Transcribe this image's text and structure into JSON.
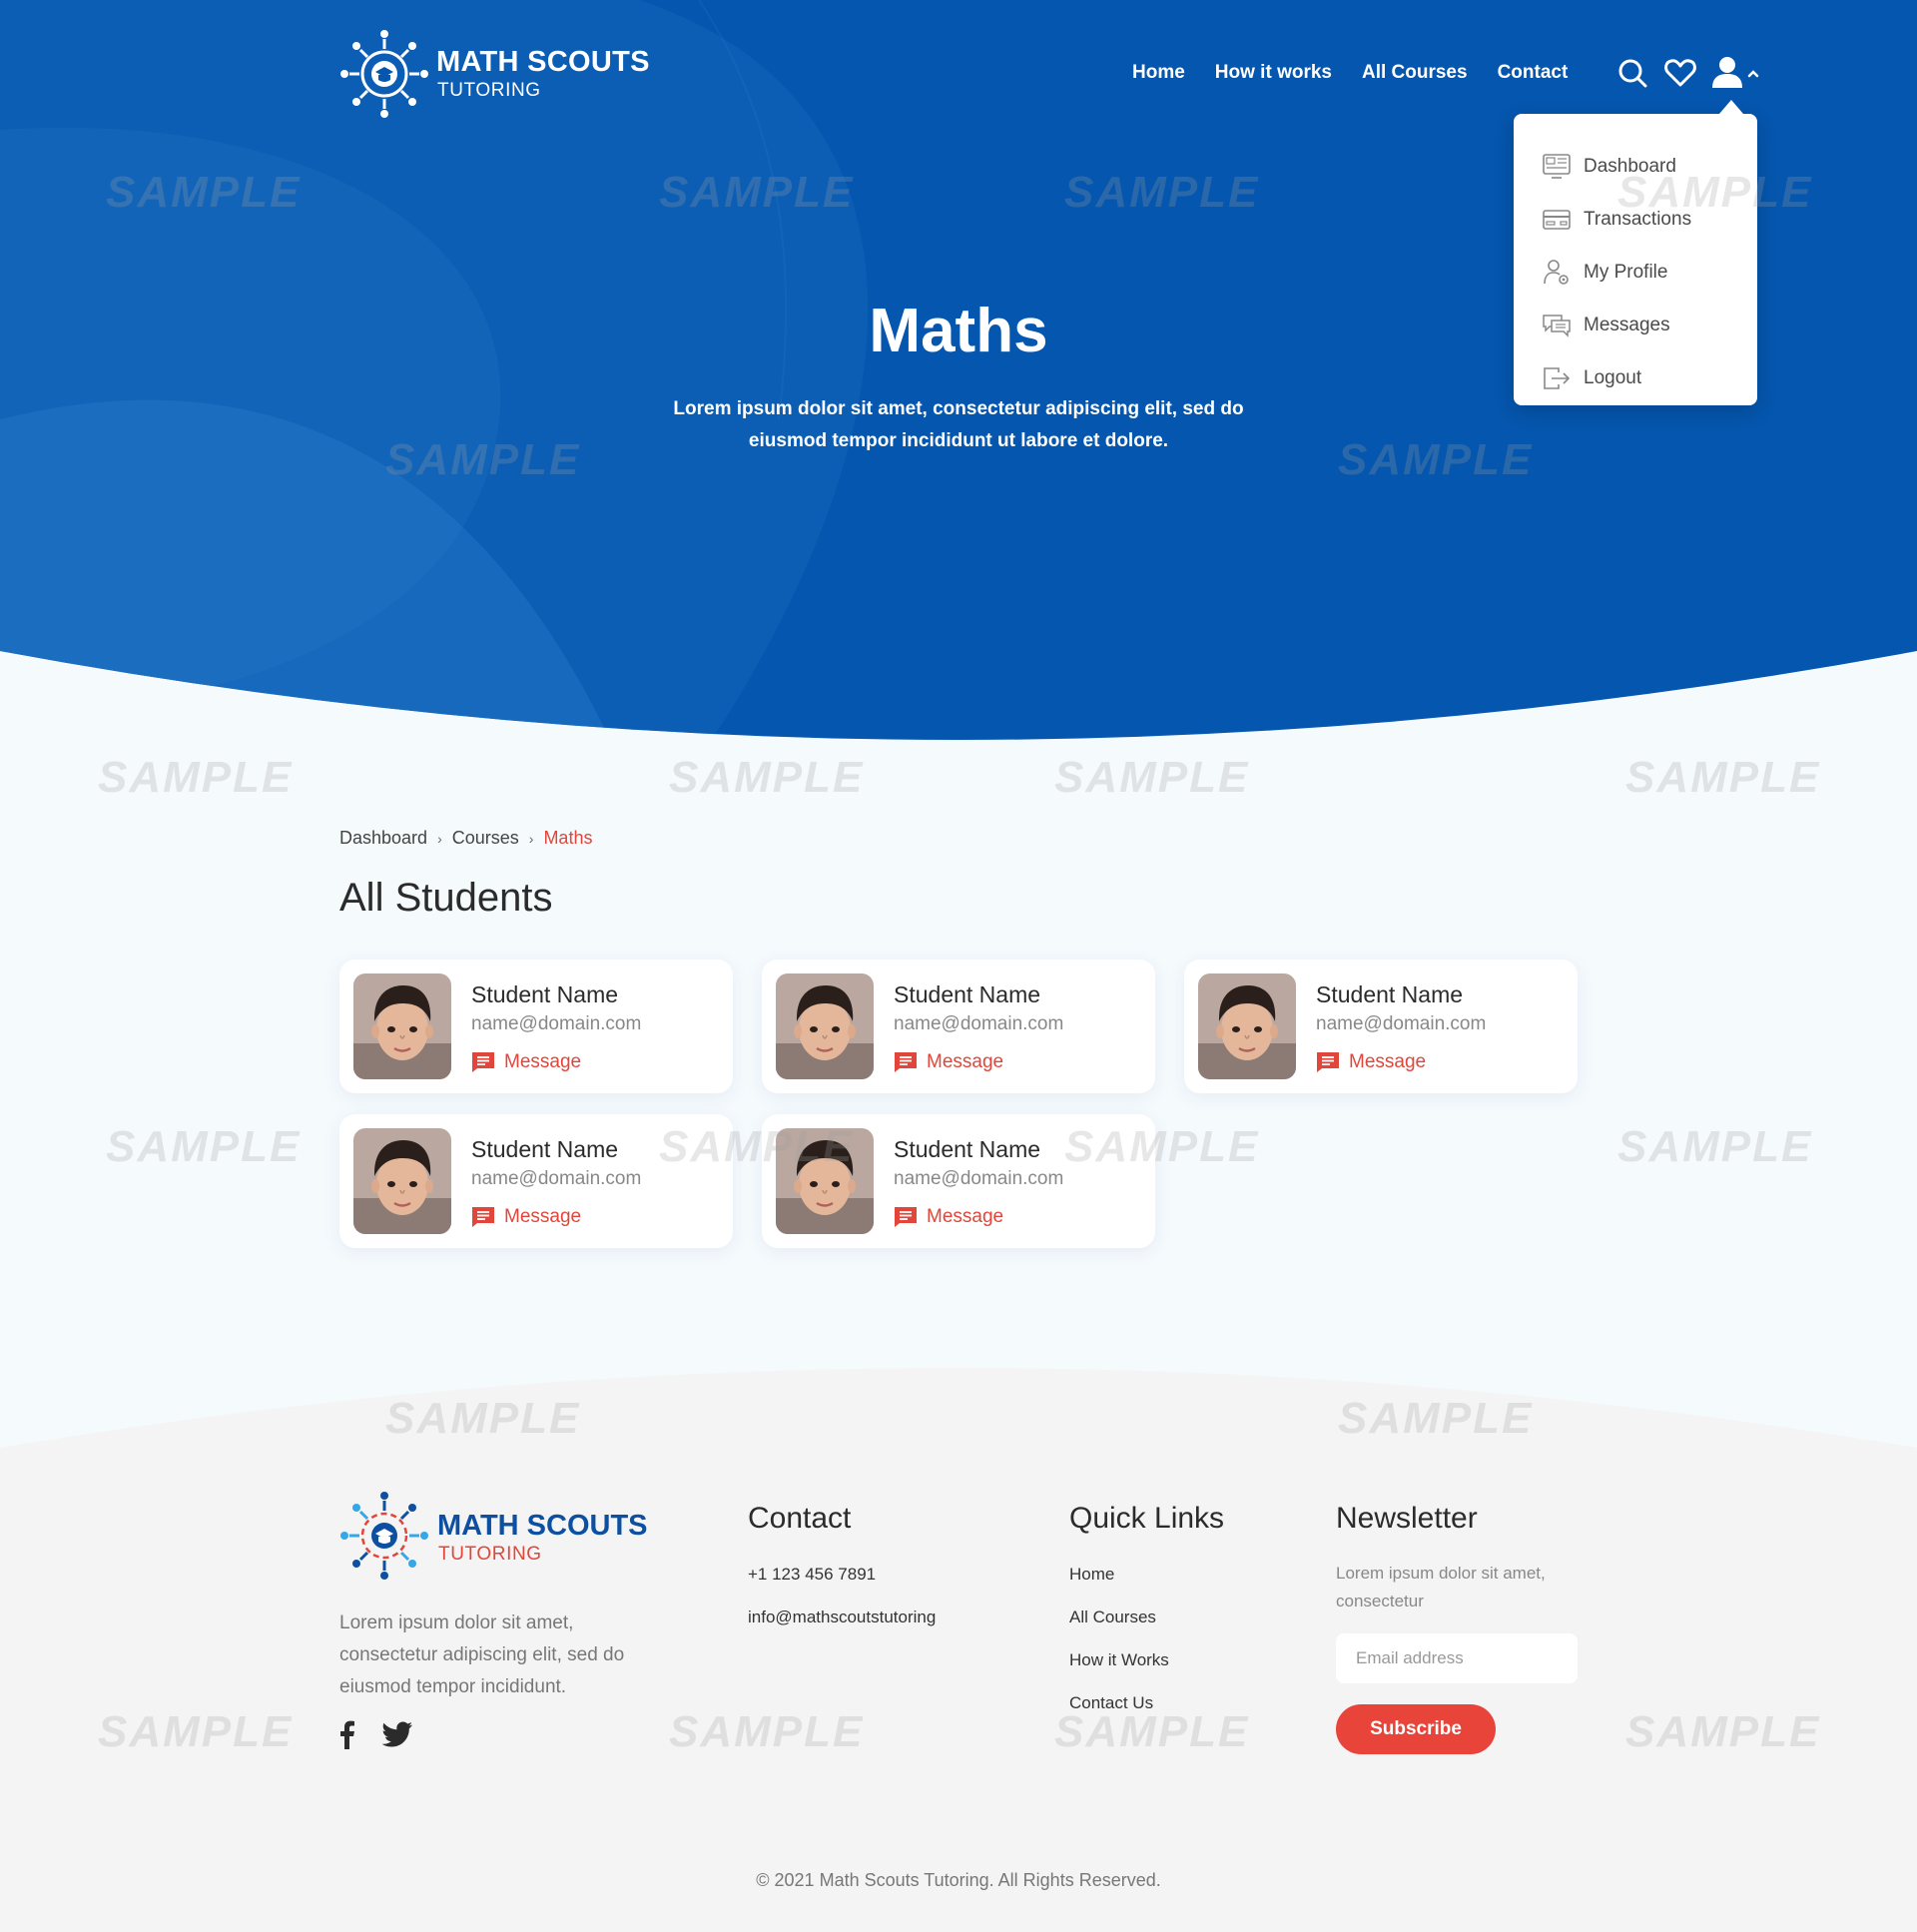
{
  "brand": {
    "name": "MATH SCOUTS",
    "tagline": "TUTORING"
  },
  "colors": {
    "hero_blue": "#0657b2",
    "hero_dark": "#04509f",
    "accent_red": "#e2453a",
    "page_bg": "#f5fafd",
    "footer_bg": "#f4f4f4"
  },
  "nav": {
    "items": [
      {
        "label": "Home"
      },
      {
        "label": "How it works"
      },
      {
        "label": "All Courses"
      },
      {
        "label": "Contact"
      }
    ],
    "icons": [
      "search-icon",
      "heart-icon",
      "user-icon",
      "chevron-up-icon"
    ]
  },
  "user_menu": {
    "items": [
      {
        "label": "Dashboard",
        "icon": "dashboard-icon"
      },
      {
        "label": "Transactions",
        "icon": "card-icon"
      },
      {
        "label": "My Profile",
        "icon": "profile-icon"
      },
      {
        "label": "Messages",
        "icon": "messages-icon"
      },
      {
        "label": "Logout",
        "icon": "logout-icon"
      }
    ]
  },
  "hero": {
    "title": "Maths",
    "text": "Lorem ipsum dolor sit amet, consectetur adipiscing elit, sed do eiusmod tempor incididunt ut labore et dolore."
  },
  "breadcrumb": {
    "items": [
      "Dashboard",
      "Courses",
      "Maths"
    ]
  },
  "page_title": "All Students",
  "students": [
    {
      "name": "Student Name",
      "email": "name@domain.com",
      "action": "Message"
    },
    {
      "name": "Student Name",
      "email": "name@domain.com",
      "action": "Message"
    },
    {
      "name": "Student Name",
      "email": "name@domain.com",
      "action": "Message"
    },
    {
      "name": "Student Name",
      "email": "name@domain.com",
      "action": "Message"
    },
    {
      "name": "Student Name",
      "email": "name@domain.com",
      "action": "Message"
    }
  ],
  "watermark": "SAMPLE",
  "footer": {
    "about": "Lorem ipsum dolor sit amet, consectetur adipiscing elit, sed do eiusmod tempor incididunt.",
    "social": [
      "facebook-icon",
      "twitter-icon"
    ],
    "contact": {
      "title": "Contact",
      "phone": "+1 123 456 7891",
      "email": "info@mathscoutstutoring"
    },
    "quick_links": {
      "title": "Quick Links",
      "items": [
        "Home",
        "All Courses",
        "How it Works",
        "Contact Us"
      ]
    },
    "newsletter": {
      "title": "Newsletter",
      "text": "Lorem ipsum dolor sit amet, consectetur",
      "placeholder": "Email address",
      "button": "Subscribe"
    },
    "copyright": "© 2021 Math Scouts Tutoring. All Rights Reserved."
  }
}
